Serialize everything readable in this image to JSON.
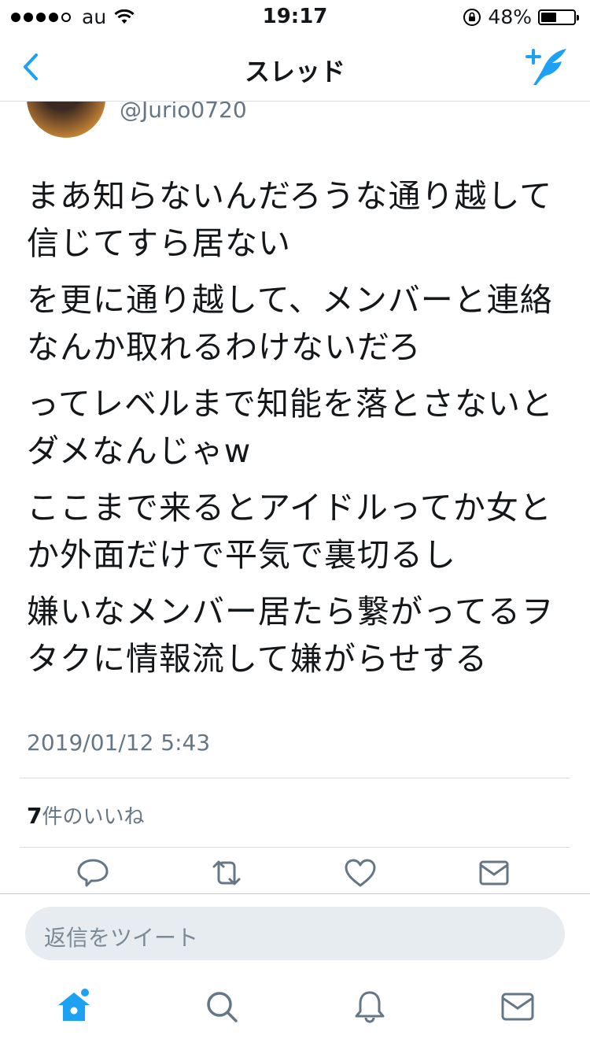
{
  "status_bar": {
    "signal_dots_filled": 4,
    "signal_dots_total": 5,
    "carrier": "au",
    "time": "19:17",
    "battery_percent": "48%",
    "battery_level": 0.48
  },
  "nav": {
    "title": "スレッド",
    "back_icon": "chevron-left-icon",
    "compose_icon": "compose-tweet-icon"
  },
  "tweet": {
    "handle": "@Jurio0720",
    "paragraphs": [
      "まあ知らないんだろうな通り越して信じてすら居ない",
      "を更に通り越して、メンバーと連絡なんか取れるわけないだろ",
      "ってレベルまで知能を落とさないとダメなんじゃw",
      "ここまで来るとアイドルってか女とか外面だけで平気で裏切るし",
      "嫌いなメンバー居たら繋がってるヲタクに情報流して嫌がらせする"
    ],
    "timestamp": "2019/01/12 5:43",
    "likes_count": "7",
    "likes_label": "件のいいね"
  },
  "actions": [
    "reply-icon",
    "retweet-icon",
    "like-icon",
    "dm-icon"
  ],
  "reply_box": {
    "placeholder": "返信をツイート"
  },
  "tabbar": [
    "home-icon",
    "search-icon",
    "notifications-icon",
    "messages-icon"
  ],
  "colors": {
    "accent": "#1da1f2",
    "muted": "#657786",
    "icon": "#657786",
    "divider": "#dbdde0"
  }
}
